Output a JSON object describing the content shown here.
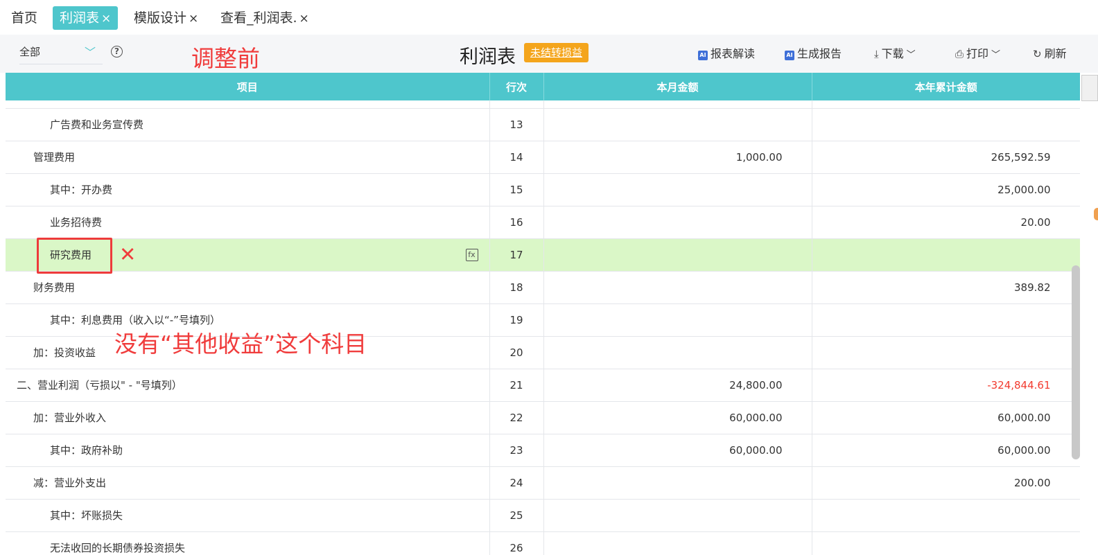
{
  "tabs": [
    {
      "label": "首页",
      "closable": false,
      "active": false
    },
    {
      "label": "利润表",
      "closable": true,
      "active": true
    },
    {
      "label": "模版设计",
      "closable": true,
      "active": false
    },
    {
      "label": "查看_利润表.",
      "closable": true,
      "active": false
    }
  ],
  "close_glyph": "×",
  "toolbar": {
    "scope_selected": "全部",
    "title": "利润表",
    "badge": "未结转损益",
    "buttons": {
      "ai_interpret": "报表解读",
      "ai_report": "生成报告",
      "download": "下载",
      "print": "打印",
      "refresh": "刷新"
    },
    "ai_tag": "AI"
  },
  "table": {
    "headers": [
      "项目",
      "行次",
      "本月金额",
      "本年累计金额"
    ],
    "rows": [
      {
        "name": "广告费和业务宣传费",
        "line": "13",
        "month": "",
        "year": ""
      },
      {
        "name": "管理费用",
        "line": "14",
        "month": "1,000.00",
        "year": "265,592.59"
      },
      {
        "name": "其中：开办费",
        "line": "15",
        "month": "",
        "year": "25,000.00"
      },
      {
        "name": "业务招待费",
        "line": "16",
        "month": "",
        "year": "20.00"
      },
      {
        "name": "研究费用",
        "line": "17",
        "month": "",
        "year": ""
      },
      {
        "name": "财务费用",
        "line": "18",
        "month": "",
        "year": "389.82"
      },
      {
        "name": "其中：利息费用（收入以“-”号填列）",
        "line": "19",
        "month": "",
        "year": ""
      },
      {
        "name": "加：投资收益",
        "line": "20",
        "month": "",
        "year": ""
      },
      {
        "name": "二、营业利润（亏损以\" - \"号填列）",
        "line": "21",
        "month": "24,800.00",
        "year": "-324,844.61"
      },
      {
        "name": "加：营业外收入",
        "line": "22",
        "month": "60,000.00",
        "year": "60,000.00"
      },
      {
        "name": "其中：政府补助",
        "line": "23",
        "month": "60,000.00",
        "year": "60,000.00"
      },
      {
        "name": "减：营业外支出",
        "line": "24",
        "month": "",
        "year": "200.00"
      },
      {
        "name": "其中：坏账损失",
        "line": "25",
        "month": "",
        "year": ""
      },
      {
        "name": "无法收回的长期债券投资损失",
        "line": "26",
        "month": "",
        "year": ""
      }
    ]
  },
  "annotations": {
    "before": "调整前",
    "cross": "✕",
    "missing": "没有“其他收益”这个科目"
  },
  "colors": {
    "accent": "#4ec6cc",
    "badge": "#f4a51c",
    "selected_row": "#daf7c7",
    "negative": "#f23b2f",
    "annotation": "#f03c3c"
  }
}
